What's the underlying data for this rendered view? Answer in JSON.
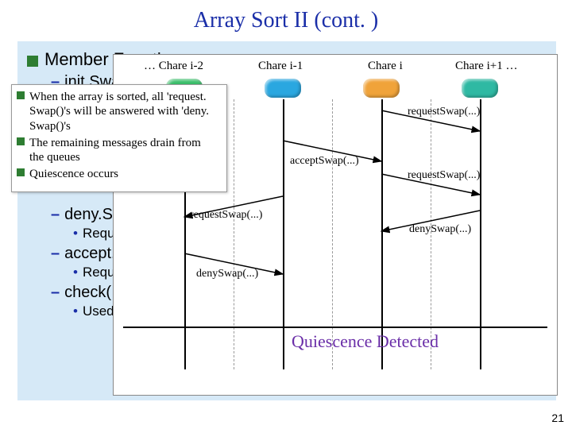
{
  "title": "Array Sort II (cont. )",
  "page_number": "21",
  "members_heading": "Member Functions",
  "items": {
    "initSwap": "init.Swap(…)",
    "denySwap": "deny.Swap(…)",
    "denySwap_sub": "Request swap denied",
    "acceptSwap": "accept.Swap(…)",
    "acceptSwap_sub": "Request swap accepted",
    "check": "check(…)",
    "check_sub": "Used to verify sort after quiescence detected"
  },
  "popup": {
    "b1": "When the array is sorted, all 'request. Swap()'s will be answered with 'deny. Swap()'s",
    "b2": "The remaining messages drain from the queues",
    "b3": "Quiescence occurs"
  },
  "diagram": {
    "col0": "… Chare i-2",
    "col1": "Chare i-1",
    "col2": "Chare i",
    "col3": "Chare i+1 …",
    "requestSwap": "requestSwap(...)",
    "acceptSwap": "acceptSwap(...)",
    "denySwap": "denySwap(...)",
    "quiescence": "Quiescence Detected"
  }
}
